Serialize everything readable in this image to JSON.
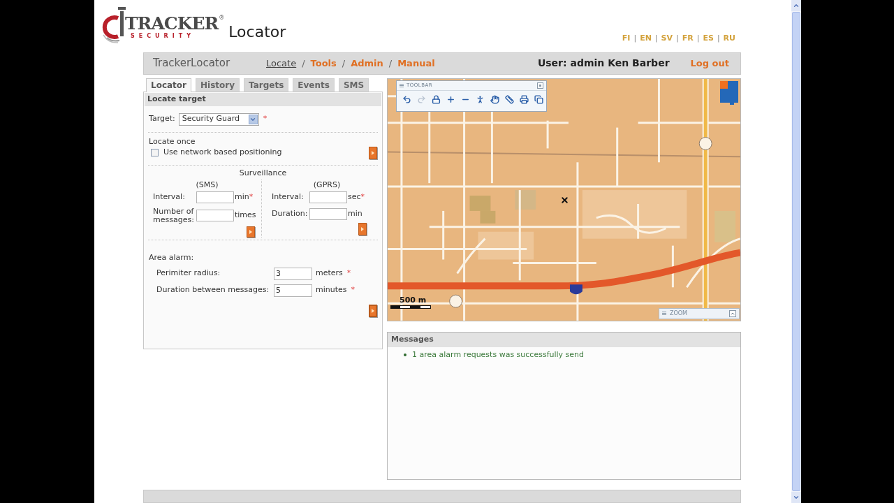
{
  "header": {
    "logo": {
      "brand": "TRACKER",
      "registered": "®",
      "tagline": "SECURITY",
      "product": "Locator"
    },
    "languages": [
      {
        "label": "FI"
      },
      {
        "label": "EN"
      },
      {
        "label": "SV"
      },
      {
        "label": "FR"
      },
      {
        "label": "ES"
      },
      {
        "label": "RU"
      }
    ],
    "language_separator": "|"
  },
  "nav": {
    "app_name": "TrackerLocator",
    "links": [
      {
        "label": "Locate",
        "selected": true
      },
      {
        "label": "Tools",
        "selected": false
      },
      {
        "label": "Admin",
        "selected": false
      },
      {
        "label": "Manual",
        "selected": false
      }
    ],
    "separator": "/",
    "user": "User: admin Ken Barber",
    "logout": "Log out"
  },
  "tabs": [
    {
      "label": "Locator",
      "selected": true
    },
    {
      "label": "History",
      "selected": false
    },
    {
      "label": "Targets",
      "selected": false
    },
    {
      "label": "Events",
      "selected": false
    },
    {
      "label": "SMS",
      "selected": false
    }
  ],
  "locate_target": {
    "title": "Locate target",
    "target": {
      "label": "Target:",
      "value": "Security Guard",
      "required": "*"
    },
    "locate_once": {
      "heading": "Locate once",
      "checkbox": {
        "label": "Use network based positioning",
        "checked": false
      }
    },
    "surveillance": {
      "heading": "Surveillance",
      "columns": [
        {
          "heading": "(SMS)",
          "fields": [
            {
              "label": "Interval:",
              "unit": "min",
              "required": "*"
            },
            {
              "label": "Number of messages:",
              "unit": "times"
            }
          ]
        },
        {
          "heading": "(GPRS)",
          "fields": [
            {
              "label": "Interval:",
              "unit": "sec",
              "required": "*"
            },
            {
              "label": "Duration:",
              "unit": "min"
            }
          ]
        }
      ]
    },
    "area_alarm": {
      "heading": "Area alarm:",
      "fields": [
        {
          "label": "Perimiter radius:",
          "value": "3",
          "unit": "meters",
          "required": "*"
        },
        {
          "label": "Duration between messages:",
          "value": "5",
          "unit": "minutes",
          "required": "*"
        }
      ]
    }
  },
  "map": {
    "toolbar": {
      "title": "TOOLBAR",
      "tools": [
        {
          "kind": "undo",
          "disabled": false
        },
        {
          "kind": "redo",
          "disabled": true
        },
        {
          "kind": "lock",
          "disabled": false
        },
        {
          "kind": "zoom_in",
          "disabled": false
        },
        {
          "kind": "zoom_out",
          "disabled": false
        },
        {
          "kind": "person",
          "disabled": false
        },
        {
          "kind": "pan",
          "disabled": false
        },
        {
          "kind": "measure",
          "disabled": false
        },
        {
          "kind": "print",
          "disabled": false
        },
        {
          "kind": "windows",
          "disabled": false
        }
      ]
    },
    "scale": "500 m",
    "zoom_panel": {
      "title": "ZOOM"
    }
  },
  "messages": {
    "title": "Messages",
    "items": [
      {
        "text": "1 area alarm requests was successfully send"
      }
    ]
  }
}
